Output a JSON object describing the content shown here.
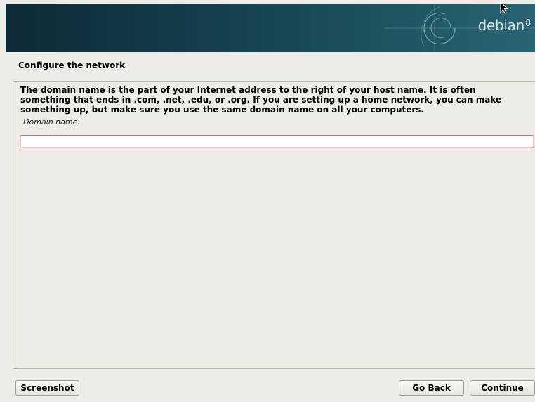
{
  "banner": {
    "brand_text": "debian",
    "brand_version": "8",
    "background_colors": [
      "#0e2a36",
      "#2a6473"
    ],
    "logo_icon": "debian-swirl-icon",
    "cursor_icon": "mouse-pointer-icon"
  },
  "page": {
    "title": "Configure the network"
  },
  "question": {
    "description": "The domain name is the part of your Internet address to the right of your host name.  It is often\nsomething that ends in .com, .net, .edu, or .org.  If you are setting up a home network, you can make\nsomething up, but make sure you use the same domain name on all your computers.",
    "field_label": "Domain name:",
    "field_value": ""
  },
  "buttons": {
    "screenshot_label": "Screenshot",
    "go_back_label": "Go Back",
    "continue_label": "Continue"
  },
  "colors": {
    "background": "#edece6",
    "input_border": "#b6707a"
  }
}
